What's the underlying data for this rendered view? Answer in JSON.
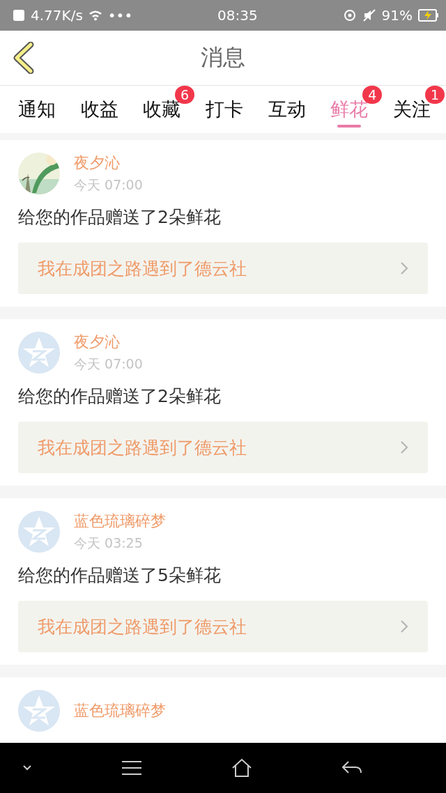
{
  "status_bar": {
    "net_speed": "4.77K/s",
    "dots": "•••",
    "time": "08:35",
    "battery": "91%"
  },
  "header": {
    "title": "消息"
  },
  "tabs": [
    {
      "label": "通知",
      "selected": false
    },
    {
      "label": "收益",
      "selected": false
    },
    {
      "label": "收藏",
      "selected": false,
      "badge": "6"
    },
    {
      "label": "打卡",
      "selected": false
    },
    {
      "label": "互动",
      "selected": false
    },
    {
      "label": "鲜花",
      "selected": true,
      "badge": "4"
    },
    {
      "label": "关注",
      "selected": false,
      "badge": "1"
    }
  ],
  "messages": [
    {
      "name": "夜夕沁",
      "time": "今天 07:00",
      "text": "给您的作品赠送了2朵鲜花",
      "work": "我在成团之路遇到了德云社"
    },
    {
      "avatar": {
        "kind": "default"
      },
      "name": "夜夕沁",
      "time": "今天 07:00",
      "text": "给您的作品赠送了2朵鲜花",
      "work": "我在成团之路遇到了德云社"
    },
    {
      "avatar": {
        "kind": "default"
      },
      "name": "蓝色琉璃碎梦",
      "time": "今天 03:25",
      "text": "给您的作品赠送了5朵鲜花",
      "work": "我在成团之路遇到了德云社"
    },
    {
      "avatar": {
        "kind": "default"
      },
      "name": "蓝色琉璃碎梦"
    }
  ]
}
